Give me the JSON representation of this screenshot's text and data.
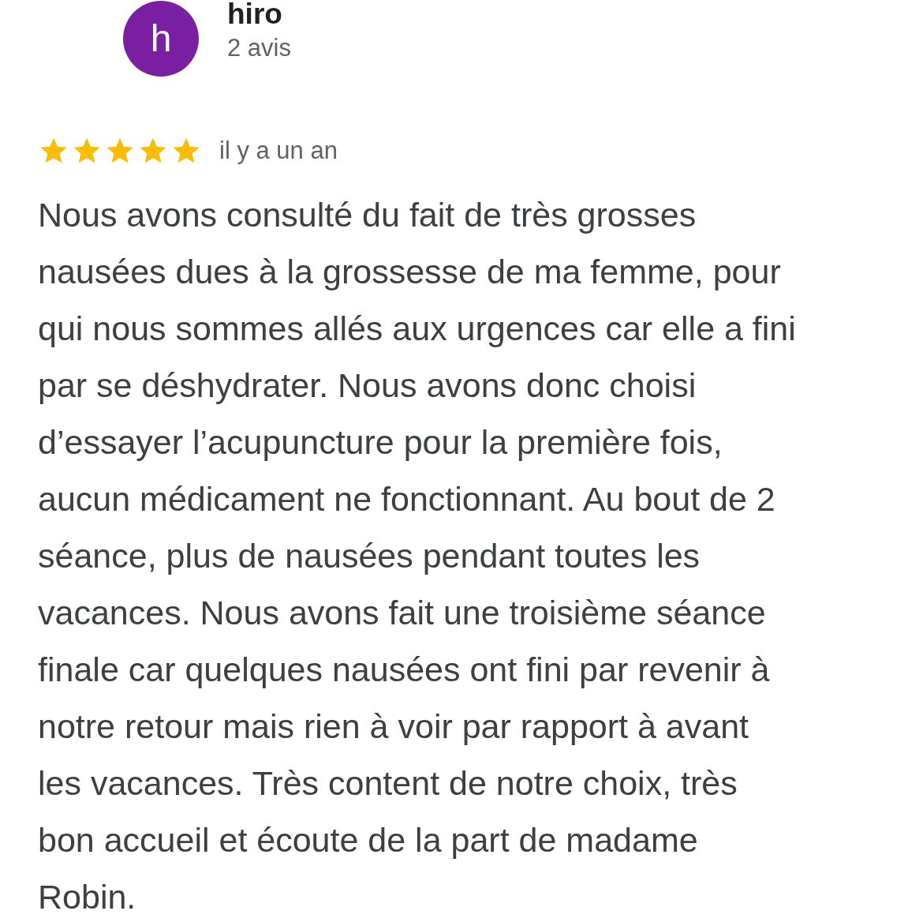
{
  "reviewer": {
    "initial": "h",
    "color": "#7b1fa2",
    "name": "hiro",
    "review_count": "2 avis"
  },
  "review": {
    "stars": 5,
    "time": "il y a un an",
    "text": "Nous avons consulté du fait de très grosses\nnausées dues à la grossesse de ma femme, pour\nqui nous sommes allés aux urgences car elle a fini\npar se déshydrater. Nous avons donc choisi\nd’essayer l’acupuncture pour la première fois,\naucun médicament ne fonctionnant. Au bout de 2\nséance, plus de nausées pendant toutes les\nvacances. Nous avons fait une troisième séance\nfinale car quelques nausées ont fini par revenir à\nnotre retour mais rien à voir par rapport à avant\nles vacances. Très content de notre choix, très\nbon accueil et écoute de la part de madame\nRobin."
  }
}
